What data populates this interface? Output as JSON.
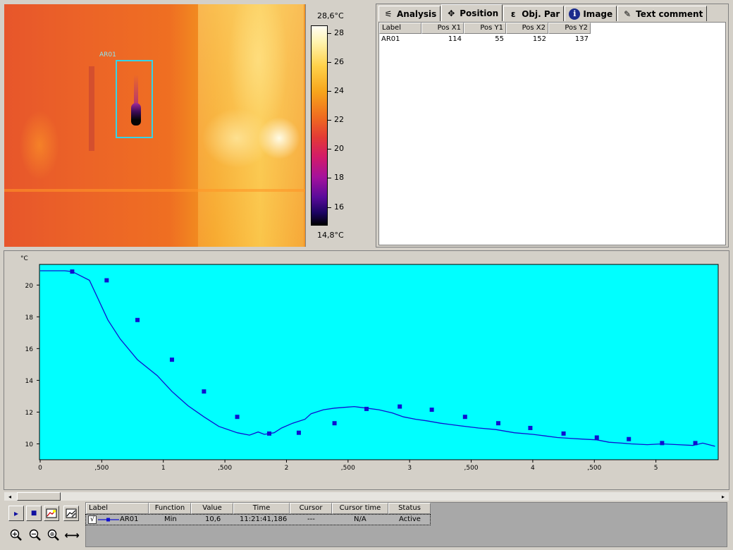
{
  "thermal": {
    "roi_label": "AR01",
    "scale_max": "28,6°C",
    "scale_min": "14,8°C",
    "scale_ticks": [
      "28",
      "26",
      "24",
      "22",
      "20",
      "18",
      "16"
    ]
  },
  "tabs": [
    {
      "label": "Analysis",
      "icon": "analysis-icon",
      "active": false
    },
    {
      "label": "Position",
      "icon": "position-icon",
      "active": true
    },
    {
      "label": "Obj. Par",
      "icon": "object-parameters-icon",
      "active": false
    },
    {
      "label": "Image",
      "icon": "info-icon",
      "active": false
    },
    {
      "label": "Text comment",
      "icon": "text-comment-icon",
      "active": false
    }
  ],
  "position_table": {
    "columns": [
      "Label",
      "Pos X1",
      "Pos Y1",
      "Pos X2",
      "Pos Y2"
    ],
    "rows": [
      [
        "AR01",
        "114",
        "55",
        "152",
        "137"
      ]
    ]
  },
  "chart_data": {
    "type": "line",
    "ylabel": "°C",
    "x_ticks": [
      "0",
      ",500",
      "1",
      ",500",
      "2",
      ",500",
      "3",
      ",500",
      "4",
      ",500",
      "5"
    ],
    "y_ticks": [
      "20",
      "18",
      "16",
      "14",
      "12",
      "10"
    ],
    "xlim": [
      0,
      5.5
    ],
    "ylim": [
      9,
      21.3
    ],
    "grid": false,
    "background": "#00ffff",
    "series": [
      {
        "name": "AR01",
        "color": "#1010d0",
        "x": [
          0,
          0.1,
          0.2,
          0.26,
          0.4,
          0.46,
          0.55,
          0.65,
          0.79,
          0.95,
          1.07,
          1.2,
          1.33,
          1.45,
          1.6,
          1.7,
          1.77,
          1.82,
          1.9,
          1.96,
          2.05,
          2.15,
          2.2,
          2.3,
          2.39,
          2.47,
          2.55,
          2.65,
          2.75,
          2.86,
          2.95,
          3.05,
          3.14,
          3.25,
          3.4,
          3.56,
          3.7,
          3.85,
          4.0,
          4.1,
          4.2,
          4.3,
          4.4,
          4.52,
          4.62,
          4.72,
          4.8,
          4.93,
          5.05,
          5.18,
          5.3,
          5.38,
          5.48
        ],
        "y": [
          20.9,
          20.9,
          20.9,
          20.85,
          20.3,
          19.3,
          17.8,
          16.6,
          15.3,
          14.3,
          13.3,
          12.4,
          11.7,
          11.1,
          10.7,
          10.55,
          10.75,
          10.6,
          10.7,
          11.0,
          11.3,
          11.55,
          11.9,
          12.15,
          12.25,
          12.3,
          12.35,
          12.25,
          12.15,
          11.95,
          11.7,
          11.55,
          11.45,
          11.3,
          11.15,
          11.0,
          10.9,
          10.7,
          10.6,
          10.5,
          10.4,
          10.35,
          10.3,
          10.25,
          10.1,
          10.05,
          10.0,
          9.95,
          10.0,
          9.95,
          9.9,
          10.05,
          9.85
        ],
        "markers_x": [
          0.26,
          0.54,
          0.79,
          1.07,
          1.33,
          1.6,
          1.86,
          2.1,
          2.39,
          2.65,
          2.92,
          3.18,
          3.45,
          3.72,
          3.98,
          4.25,
          4.52,
          4.78,
          5.05,
          5.32
        ],
        "markers_y": [
          20.85,
          20.3,
          17.8,
          15.3,
          13.3,
          11.7,
          10.65,
          10.7,
          11.3,
          12.2,
          12.35,
          12.15,
          11.7,
          11.3,
          11.0,
          10.65,
          10.4,
          10.3,
          10.05,
          10.05
        ]
      }
    ]
  },
  "legend_table": {
    "columns": [
      "Label",
      "Function",
      "Value",
      "Time",
      "Cursor",
      "Cursor time",
      "Status"
    ],
    "row": {
      "checked": "√",
      "label": "AR01",
      "function": "Min",
      "value": "10,6",
      "time": "11:21:41,186",
      "cursor": "---",
      "cursor_time": "N/A",
      "status": "Active"
    }
  },
  "toolbar": {
    "play": "▸",
    "stop": "■",
    "zoom_in": "+",
    "zoom_out": "−",
    "zoom_fit": "⊕",
    "pan": "⟷"
  }
}
